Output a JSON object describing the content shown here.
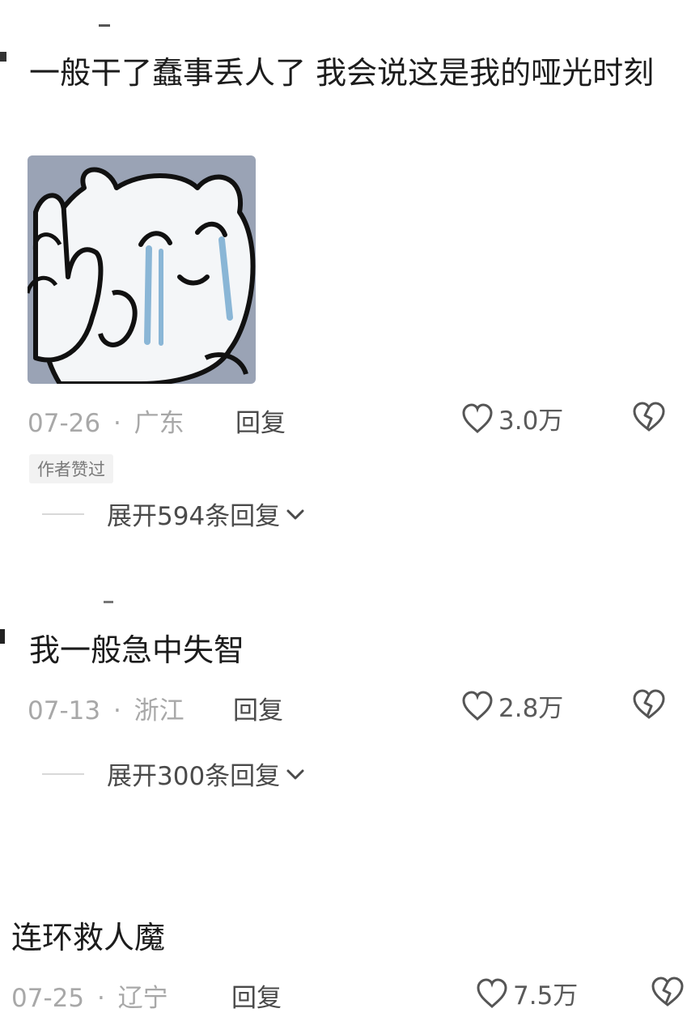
{
  "comments": [
    {
      "text": "一般干了蠢事丢人了 我会说这是我的哑光时刻",
      "date": "07-26",
      "separator": "·",
      "location": "广东",
      "reply": "回复",
      "likes": "3.0万",
      "badge": "作者赞过",
      "expand": "展开594条回复",
      "sticker": "crying-cat-waving-sticker"
    },
    {
      "text": "我一般急中失智",
      "date": "07-13",
      "separator": "·",
      "location": "浙江",
      "reply": "回复",
      "likes": "2.8万",
      "expand": "展开300条回复"
    },
    {
      "text": "连环救人魔",
      "date": "07-25",
      "separator": "·",
      "location": "辽宁",
      "reply": "回复",
      "likes": "7.5万"
    }
  ],
  "icons": {
    "like": "heart-outline-icon",
    "dislike": "broken-heart-icon",
    "expand": "chevron-down-icon"
  },
  "colors": {
    "text": "#1c1c1c",
    "meta": "#a8a8a8",
    "action": "#4a4a4a",
    "badge_bg": "#f2f2f2",
    "sticker_bg": "#9aa3b5"
  }
}
